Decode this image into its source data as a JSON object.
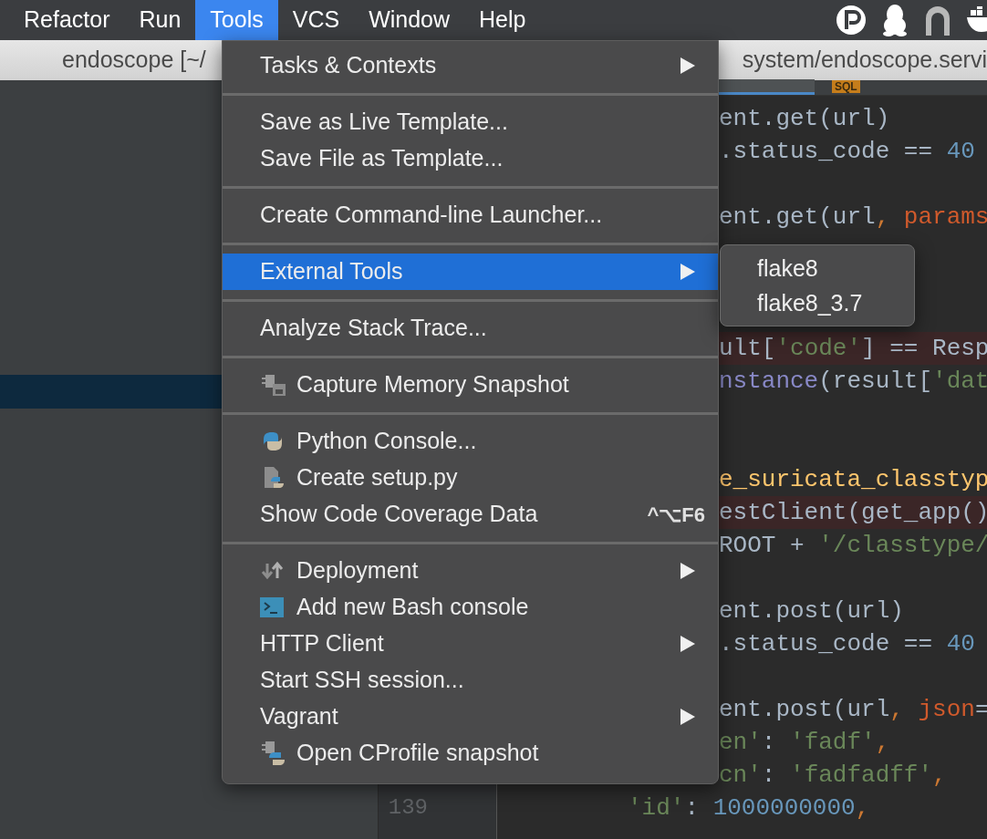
{
  "menubar": {
    "items": [
      {
        "label": "Refactor",
        "selected": false
      },
      {
        "label": "Run",
        "selected": false
      },
      {
        "label": "Tools",
        "selected": true
      },
      {
        "label": "VCS",
        "selected": false
      },
      {
        "label": "Window",
        "selected": false
      },
      {
        "label": "Help",
        "selected": false
      }
    ]
  },
  "title_bar": {
    "title_left": "endoscope [~/",
    "title_right": "system/endoscope.servi"
  },
  "editor_tabs": [
    {
      "selected": true
    },
    {
      "selected": false,
      "badge": "SQL"
    }
  ],
  "project_panel": {
    "selection_visible": true
  },
  "code_lines": [
    {
      "kind": "tail",
      "error": false,
      "segments": [
        {
          "text": "ent.get(url)",
          "kind": "plain"
        }
      ]
    },
    {
      "kind": "tail",
      "error": false,
      "segments": [
        {
          "text": ".status_code == ",
          "kind": "plain"
        },
        {
          "text": "40",
          "kind": "number"
        }
      ]
    },
    {
      "kind": "blank",
      "error": false
    },
    {
      "kind": "tail",
      "error": false,
      "segments": [
        {
          "text": "ent.get(url",
          "kind": "plain"
        },
        {
          "text": ", ",
          "kind": "keyword"
        },
        {
          "text": "params",
          "kind": "param"
        }
      ]
    },
    {
      "kind": "blank",
      "error": false
    },
    {
      "kind": "blank",
      "error": false
    },
    {
      "kind": "blank",
      "error": false
    },
    {
      "kind": "tail",
      "error": true,
      "segments": [
        {
          "text": "ult[",
          "kind": "plain"
        },
        {
          "text": "'code'",
          "kind": "string"
        },
        {
          "text": "] == Resp",
          "kind": "plain"
        }
      ]
    },
    {
      "kind": "tail",
      "error": false,
      "segments": [
        {
          "text": "nstance",
          "kind": "builtin"
        },
        {
          "text": "(result[",
          "kind": "plain"
        },
        {
          "text": "'dat",
          "kind": "string"
        }
      ]
    },
    {
      "kind": "blank",
      "error": false
    },
    {
      "kind": "blank",
      "error": false
    },
    {
      "kind": "tail",
      "error": false,
      "segments": [
        {
          "text": "e_suricata_classtyp",
          "kind": "function"
        }
      ]
    },
    {
      "kind": "tail",
      "error": true,
      "segments": [
        {
          "text": "estClient(get_app()",
          "kind": "plain"
        }
      ]
    },
    {
      "kind": "tail",
      "error": false,
      "segments": [
        {
          "text": "ROOT + ",
          "kind": "plain"
        },
        {
          "text": "'/classtype/",
          "kind": "string"
        }
      ]
    },
    {
      "kind": "blank",
      "error": false
    },
    {
      "kind": "tail",
      "error": false,
      "segments": [
        {
          "text": "ent.post(url)",
          "kind": "plain"
        }
      ]
    },
    {
      "kind": "tail",
      "error": false,
      "segments": [
        {
          "text": ".status_code == ",
          "kind": "plain"
        },
        {
          "text": "40",
          "kind": "number"
        }
      ]
    },
    {
      "kind": "blank",
      "error": false
    },
    {
      "kind": "tail",
      "error": false,
      "segments": [
        {
          "text": "ent.post(url",
          "kind": "plain"
        },
        {
          "text": ", ",
          "kind": "keyword"
        },
        {
          "text": "json",
          "kind": "param"
        },
        {
          "text": "=",
          "kind": "plain"
        }
      ]
    },
    {
      "kind": "tail",
      "error": false,
      "segments": [
        {
          "text": "en'",
          "kind": "string"
        },
        {
          "text": ": ",
          "kind": "plain"
        },
        {
          "text": "'fadf'",
          "kind": "string"
        },
        {
          "text": ",",
          "kind": "keyword"
        }
      ]
    },
    {
      "kind": "tail",
      "error": false,
      "segments": [
        {
          "text": "cn'",
          "kind": "string"
        },
        {
          "text": ": ",
          "kind": "plain"
        },
        {
          "text": "'fadfadff'",
          "kind": "string"
        },
        {
          "text": ",",
          "kind": "keyword"
        }
      ]
    },
    {
      "kind": "full",
      "error": false,
      "number": "139",
      "segments": [
        {
          "text": "'id'",
          "kind": "string"
        },
        {
          "text": ": ",
          "kind": "plain"
        },
        {
          "text": "1000000000",
          "kind": "number"
        },
        {
          "text": ",",
          "kind": "keyword"
        }
      ]
    }
  ],
  "tools_menu": {
    "items": [
      {
        "kind": "item",
        "label": "Tasks & Contexts",
        "submenu": true,
        "selected": false
      },
      {
        "kind": "separator"
      },
      {
        "kind": "item",
        "label": "Save as Live Template...",
        "submenu": false,
        "selected": false
      },
      {
        "kind": "item",
        "label": "Save File as Template...",
        "submenu": false,
        "selected": false
      },
      {
        "kind": "separator"
      },
      {
        "kind": "item",
        "label": "Create Command-line Launcher...",
        "submenu": false,
        "selected": false
      },
      {
        "kind": "separator"
      },
      {
        "kind": "item",
        "label": "External Tools",
        "submenu": true,
        "selected": true
      },
      {
        "kind": "separator"
      },
      {
        "kind": "item",
        "label": "Analyze Stack Trace...",
        "submenu": false,
        "selected": false
      },
      {
        "kind": "separator"
      },
      {
        "kind": "item",
        "label": "Capture Memory Snapshot",
        "submenu": false,
        "selected": false
      },
      {
        "kind": "separator"
      },
      {
        "kind": "item",
        "label": "Python Console...",
        "submenu": false,
        "selected": false
      },
      {
        "kind": "item",
        "label": "Create setup.py",
        "submenu": false,
        "selected": false
      },
      {
        "kind": "item",
        "label": "Show Code Coverage Data",
        "shortcut": "^⌥F6",
        "submenu": false,
        "selected": false
      },
      {
        "kind": "separator"
      },
      {
        "kind": "item",
        "label": "Deployment",
        "submenu": true,
        "selected": false
      },
      {
        "kind": "item",
        "label": "Add new Bash console",
        "submenu": false,
        "selected": false
      },
      {
        "kind": "item",
        "label": "HTTP Client",
        "submenu": true,
        "selected": false
      },
      {
        "kind": "item",
        "label": "Start SSH session...",
        "submenu": false,
        "selected": false
      },
      {
        "kind": "item",
        "label": "Vagrant",
        "submenu": true,
        "selected": false
      },
      {
        "kind": "item",
        "label": "Open CProfile snapshot",
        "submenu": false,
        "selected": false
      }
    ]
  },
  "external_tools_submenu": {
    "items": [
      {
        "label": "flake8"
      },
      {
        "label": "flake8_3.7"
      }
    ]
  }
}
